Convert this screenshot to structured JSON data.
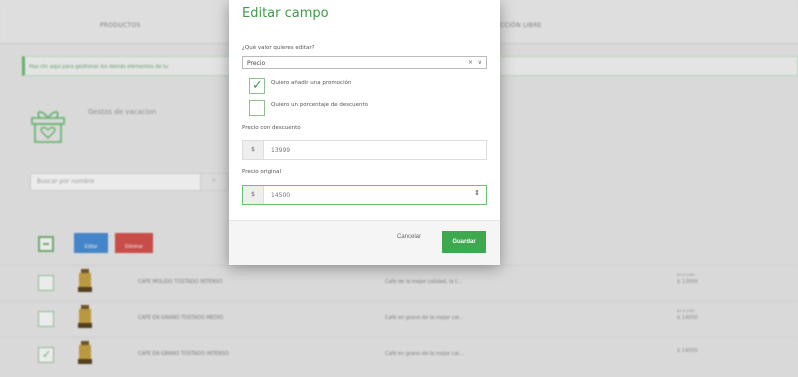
{
  "tabs": {
    "products": "PRODUCTOS",
    "free_section": "CCIÓN LIBRE"
  },
  "banner": {
    "text": "Haz clic aquí para gestionar los demás elementos de tu"
  },
  "group": {
    "icon": "gift-heart-icon",
    "title": "Gestos de vacacion"
  },
  "search": {
    "placeholder": "Buscar por nombre",
    "icon": "search-icon"
  },
  "actions": {
    "edit": "Editar",
    "delete": "Eliminar"
  },
  "rows": [
    {
      "checked": false,
      "name": "CAFE MOLIDO TOSTADO INTENSO",
      "desc": "Café de la mejor calidad, la t...",
      "promo": "a+++an",
      "price": "$ 13999"
    },
    {
      "checked": false,
      "name": "CAFE EN GRANO TOSTADO MEDIO",
      "desc": "Café en grano de la mejor cal...",
      "promo": "a+++an",
      "price": "$ 14000"
    },
    {
      "checked": true,
      "name": "CAFE EN GRANO TOSTADO INTENSO",
      "desc": "Café en grano de la mejor cal...",
      "promo": "",
      "price": "$ 14000"
    }
  ],
  "modal": {
    "title": "Editar campo",
    "question": "¿Qué valor quieres editar?",
    "select_value": "Precio",
    "clear_icon": "×",
    "chevron_icon": "∨",
    "option_promo": "Quiero añadir una promoción",
    "option_promo_checked": true,
    "option_discount": "Quiero un porcentaje de descuento",
    "option_discount_checked": false,
    "discount_label": "Precio con descuento",
    "currency": "$",
    "discount_value": "13999",
    "original_label": "Precio original",
    "original_value": "14500",
    "spinner_icon": "⇕",
    "cancel": "Cancelar",
    "save": "Guardar"
  },
  "colors": {
    "accent": "#3ea84f",
    "edit": "#4a90d9",
    "delete": "#d9534f"
  }
}
